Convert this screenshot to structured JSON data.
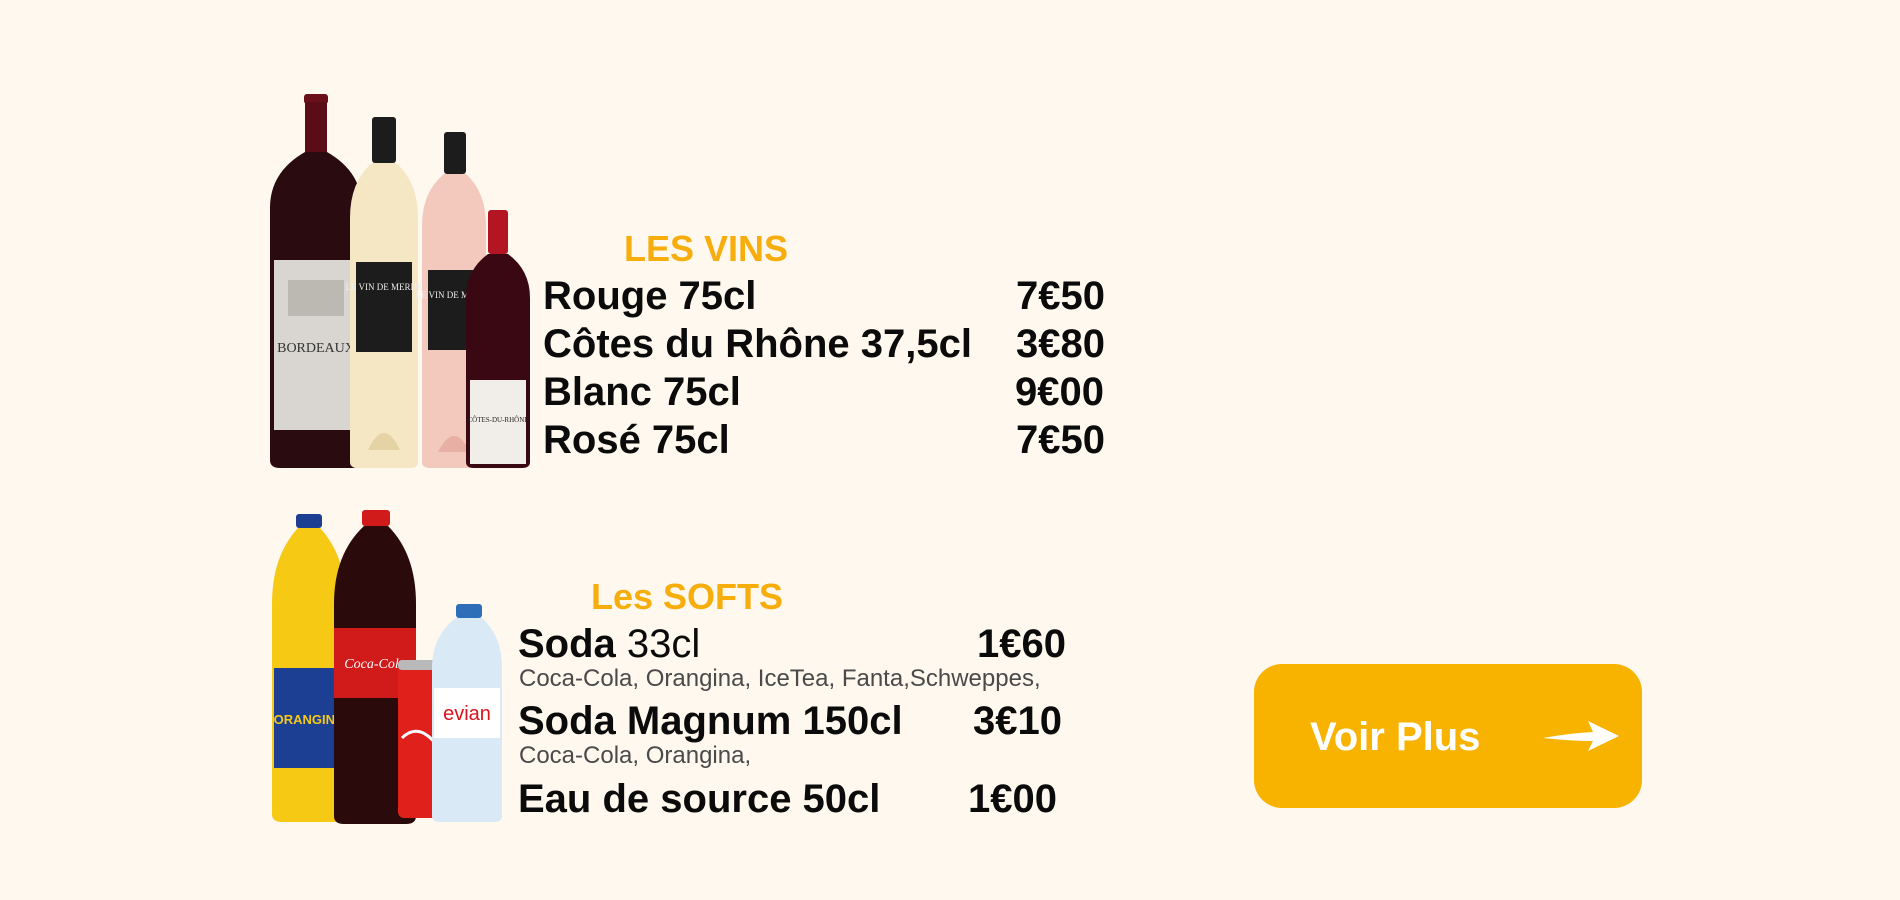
{
  "wines": {
    "title": "LES VINS",
    "items": [
      {
        "name": "Rouge 75cl",
        "price": "7€50"
      },
      {
        "name": "Côtes du Rhône 37,5cl",
        "price": "3€80"
      },
      {
        "name": "Blanc 75cl",
        "price": "9€00"
      },
      {
        "name": "Rosé 75cl",
        "price": "7€50"
      }
    ],
    "image_labels": {
      "bordeaux": "BORDEAUX",
      "vin_blanc": "LE VIN DE MERDE",
      "vin_rose": "LE VIN DE MERDE",
      "cotes": "CÔTES-DU-RHÔNE"
    }
  },
  "softs": {
    "title": "Les SOFTS",
    "items": [
      {
        "name": "Soda",
        "name_suffix": " 33cl",
        "price": "1€60",
        "desc": "Coca-Cola, Orangina, IceTea, Fanta,Schweppes,"
      },
      {
        "name": "Soda Magnum 150cl",
        "price": "3€10",
        "desc": "Coca-Cola, Orangina,"
      },
      {
        "name": "Eau de source 50cl",
        "price": "1€00"
      }
    ],
    "image_labels": {
      "orangina": "ORANGINA",
      "coca": "Coca-Cola",
      "evian": "evian"
    }
  },
  "cta": {
    "label": "Voir Plus",
    "icon": "arrow-right-icon"
  },
  "colors": {
    "background": "#fef8ee",
    "accent": "#f7ad0b",
    "button": "#f8b200",
    "text": "#0b0b0b"
  }
}
